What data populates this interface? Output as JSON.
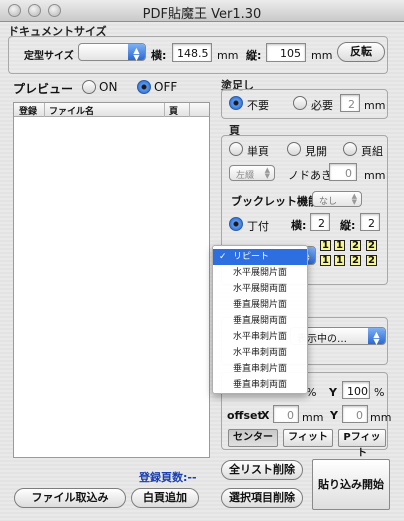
{
  "window": {
    "title": "PDF貼魔王 Ver1.30"
  },
  "document_size": {
    "title": "ドキュメントサイズ",
    "preset_label": "定型サイズ",
    "preset_value": "",
    "width_label": "横:",
    "width_value": "148.5",
    "height_label": "縦:",
    "height_value": "105",
    "unit": "mm",
    "rotate_button": "反転"
  },
  "preview": {
    "label": "プレビュー",
    "on_label": "ON",
    "off_label": "OFF",
    "selected": "OFF",
    "columns": [
      "登録",
      "ファイル名",
      "頁"
    ]
  },
  "bleed": {
    "title": "塗足し",
    "none_label": "不要",
    "need_label": "必要",
    "value": "2",
    "unit": "mm",
    "selected": "none"
  },
  "page": {
    "title": "頁",
    "single_label": "単頁",
    "spread_label": "見開",
    "set_label": "頁組",
    "binding_value": "左綴",
    "gutter_label": "ノドあき",
    "gutter_value": "0",
    "gutter_unit": "mm",
    "booklet_label": "ブックレット機能",
    "booklet_value": "なし",
    "imposition_label": "丁付",
    "cols_label": "横:",
    "cols_value": "2",
    "rows_label": "縦:",
    "rows_value": "2",
    "preview_grid": [
      [
        "1",
        "1",
        "2",
        "2"
      ],
      [
        "1",
        "1",
        "2",
        "2"
      ]
    ]
  },
  "dropdown_menu": {
    "items": [
      "リピート",
      "水平展開片面",
      "水平展開両面",
      "垂直展開片面",
      "垂直展開両面",
      "水平串刺片面",
      "水平串刺両面",
      "垂直串刺片面",
      "垂直串刺両面"
    ],
    "selected_index": 0,
    "checkmark": "✓"
  },
  "display": {
    "popup_value": "表示中の…"
  },
  "scale": {
    "percent_unit": "%",
    "y_label": "Y",
    "y_value": "100",
    "offset_label": "offset",
    "x_label": "X",
    "offset_x_value": "0",
    "offset_y_value": "0",
    "unit": "mm",
    "center_button": "センター",
    "fit_button": "フィット",
    "pfit_button": "Pフィット"
  },
  "footer": {
    "page_count_label": "登録頁数:--",
    "load_files_button": "ファイル取込み",
    "add_blank_button": "白頁追加",
    "clear_all_button": "全リスト削除",
    "delete_selected_button": "選択項目削除",
    "start_button": "貼り込み開始"
  },
  "colors": {
    "accent": "#2d6fe0",
    "grid_fill": "#f7f78f",
    "count_text": "#1a3fb0"
  }
}
